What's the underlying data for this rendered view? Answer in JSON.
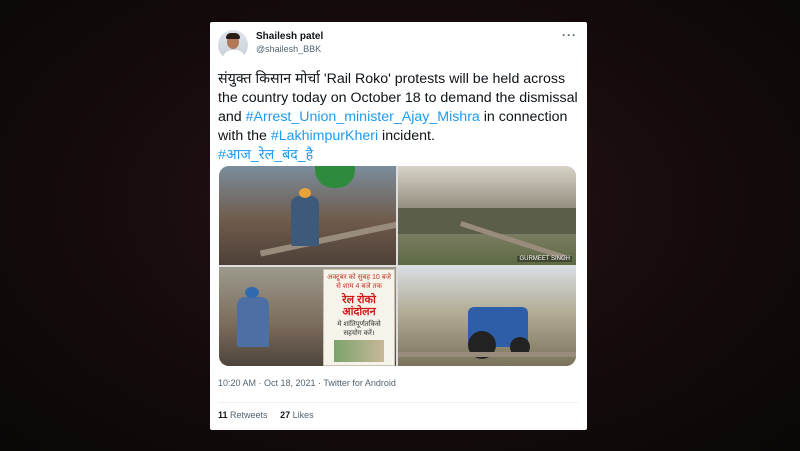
{
  "tweet": {
    "author_name": "Shailesh patel",
    "author_handle": "@shailesh_BBK",
    "more_label": "···",
    "text_1": "संयुक्त किसान मोर्चा 'Rail Roko' protests will be held across the country today on October 18 to demand the dismissal and ",
    "hashtag_1": "#Arrest_Union_minister_Ajay_Mishra",
    "text_2": " in connection with the ",
    "hashtag_2": "#LakhimpurKheri",
    "text_3": " incident.",
    "hashtag_3": "#आज_रेल_बंद_है",
    "timestamp": "10:20 AM · Oct 18, 2021 · Twitter for Android",
    "retweets_count": "11",
    "retweets_label": "Retweets",
    "likes_count": "27",
    "likes_label": "Likes"
  },
  "media": {
    "photo_credit": "GURMEET SINGH",
    "poster": {
      "line1": "अक्टूबर को सुबह 10 बजे",
      "line2": "से शाम 4 बजे तक",
      "line3": "रेल रोको आंदोलन",
      "line4": "मे शांतिपूर्णतकिसे",
      "line5": "सहयोग करें।"
    }
  },
  "colors": {
    "link": "#1d9bf0",
    "text": "#0f1419",
    "muted": "#536471"
  }
}
